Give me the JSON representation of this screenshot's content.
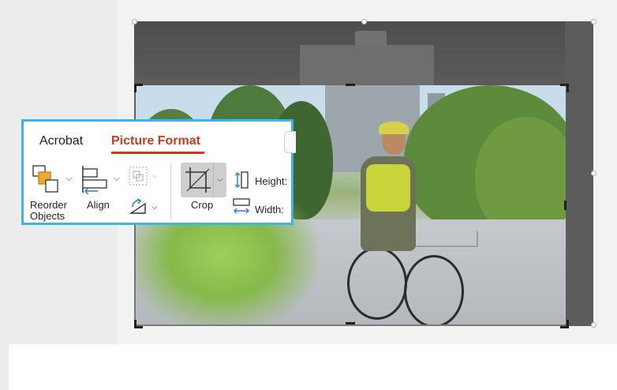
{
  "ribbon": {
    "tabs": [
      {
        "label": "Acrobat",
        "active": false
      },
      {
        "label": "Picture Format",
        "active": true
      }
    ],
    "reorder_label_line1": "Reorder",
    "reorder_label_line2": "Objects",
    "align_label": "Align",
    "crop_label": "Crop",
    "height_label": "Height:",
    "width_label": "Width:",
    "accent_color": "#c43e1c",
    "highlight_border_color": "#3fb4e5"
  },
  "picture": {
    "state": "cropping"
  }
}
